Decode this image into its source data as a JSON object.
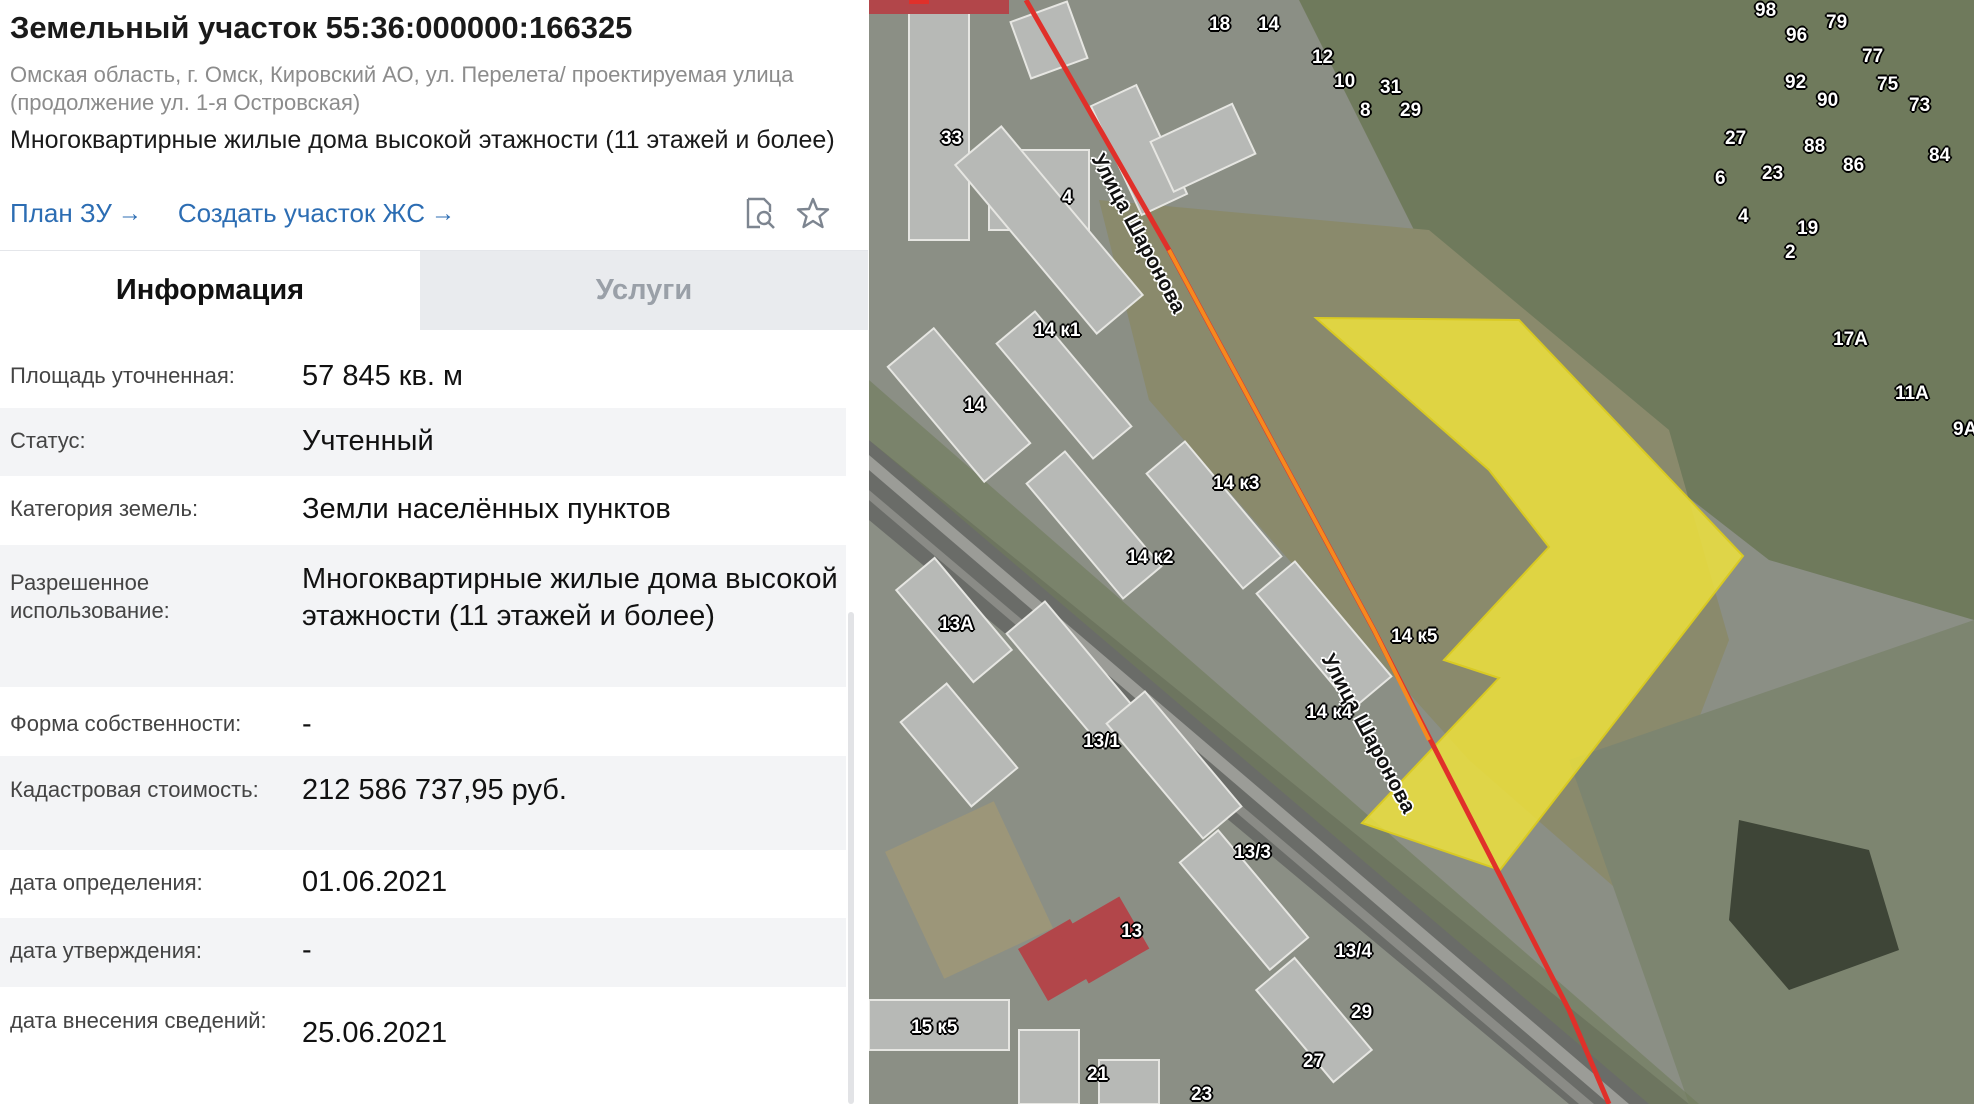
{
  "header": {
    "title": "Земельный участок 55:36:000000:166325",
    "address": "Омская область, г. Омск, Кировский АО, ул. Перелета/ проектируемая улица (продолжение ул. 1-я Островская)",
    "purpose": "Многоквартирные жилые дома высокой этажности (11 этажей и более)"
  },
  "links": {
    "plan": "План ЗУ",
    "create": "Создать участок ЖС",
    "arrow": "→"
  },
  "icons": {
    "search_doc": "document-search-icon",
    "favorite": "star-icon"
  },
  "tabs": {
    "info": "Информация",
    "services": "Услуги"
  },
  "rows": [
    {
      "label": "Площадь уточненная:",
      "value": "57 845 кв. м"
    },
    {
      "label": "Статус:",
      "value": "Учтенный"
    },
    {
      "label": "Категория земель:",
      "value": "Земли населённых пунктов"
    },
    {
      "label": "Разрешенное использование:",
      "value": "Многоквартирные жилые дома высокой этажности (11 этажей и более)"
    },
    {
      "label": "Форма собственности:",
      "value": "-"
    },
    {
      "label": "Кадастровая стоимость:",
      "value": "212 586 737,95 руб."
    },
    {
      "label": "дата определения:",
      "value": "01.06.2021"
    },
    {
      "label": "дата утверждения:",
      "value": "-"
    },
    {
      "label": "дата внесения сведений:",
      "value": "25.06.2021"
    }
  ],
  "map": {
    "street_name": "Улица Шаронова",
    "parcel_color": "#f2e43a",
    "road_color": "#e0302a",
    "house_numbers": [
      "18",
      "14",
      "98",
      "96",
      "79",
      "77",
      "12",
      "10",
      "31",
      "8",
      "29",
      "92",
      "90",
      "75",
      "73",
      "33",
      "27",
      "88",
      "86",
      "84",
      "4",
      "6",
      "23",
      "4",
      "19",
      "2",
      "14 к1",
      "17А",
      "11А",
      "14",
      "9А",
      "14 к3",
      "14 к2",
      "13А",
      "14 к5",
      "14 к4",
      "13/1",
      "13/3",
      "13",
      "13/4",
      "29",
      "15 к5",
      "27",
      "21",
      "23"
    ]
  }
}
